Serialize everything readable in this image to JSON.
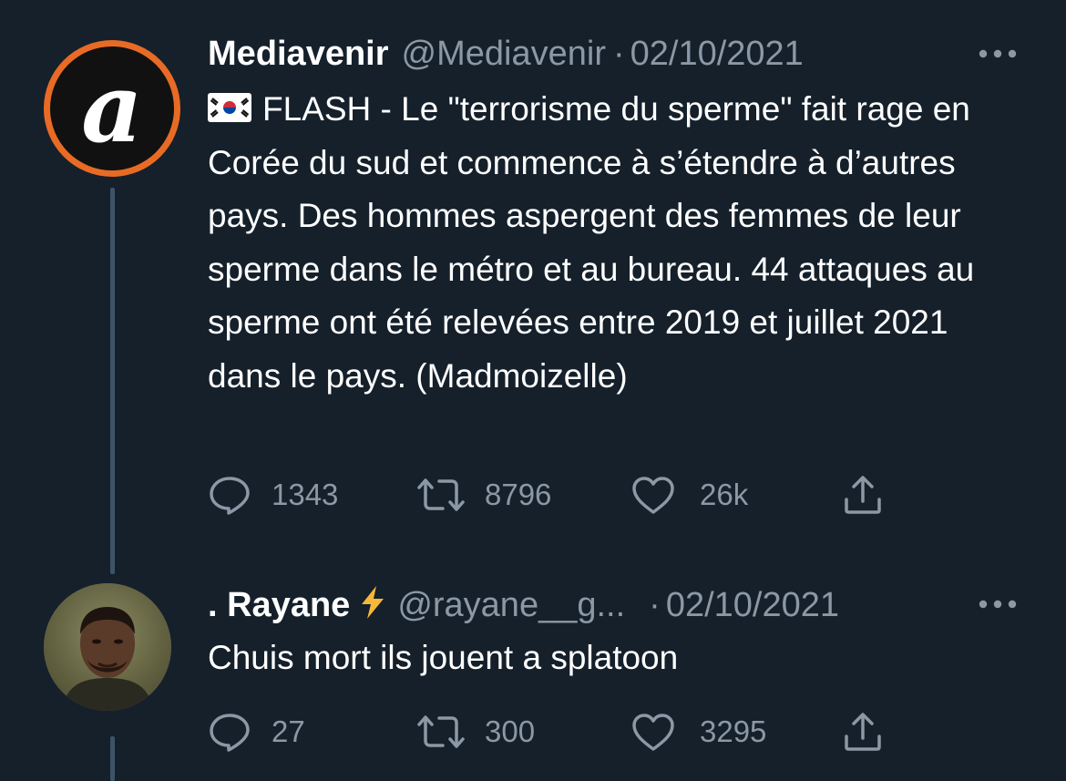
{
  "tweets": [
    {
      "name": "Mediavenir",
      "handle": "@Mediavenir",
      "separator": "·",
      "date": "02/10/2021",
      "flag_emoji": "🇰🇷",
      "text": "FLASH - Le \"terrorisme du sperme\" fait rage en Corée du sud et commence à s’étendre à d’autres pays. Des hommes aspergent des femmes de leur sperme dans le métro et au bureau. 44 attaques au sperme ont été relevées entre 2019 et juillet 2021 dans le pays. (Madmoizelle)",
      "avatar_icon": "mediavenir-logo-icon",
      "avatar_letter": "a",
      "replies": "1343",
      "retweets": "8796",
      "likes": "26k"
    },
    {
      "name": ". Rayane",
      "name_emoji": "⚡",
      "handle": "@rayane__g...",
      "separator": "·",
      "date": "02/10/2021",
      "text": "Chuis mort ils jouent a splatoon",
      "avatar_icon": "profile-photo",
      "replies": "27",
      "retweets": "300",
      "likes": "3295"
    }
  ],
  "icons": {
    "reply": "reply-icon",
    "retweet": "retweet-icon",
    "like": "heart-icon",
    "share": "share-icon",
    "more": "more-icon"
  },
  "colors": {
    "background": "#15202b",
    "text": "#ffffff",
    "muted": "#8b98a5",
    "thread_line": "#3d5466",
    "avatar_ring": "#e86b25"
  }
}
